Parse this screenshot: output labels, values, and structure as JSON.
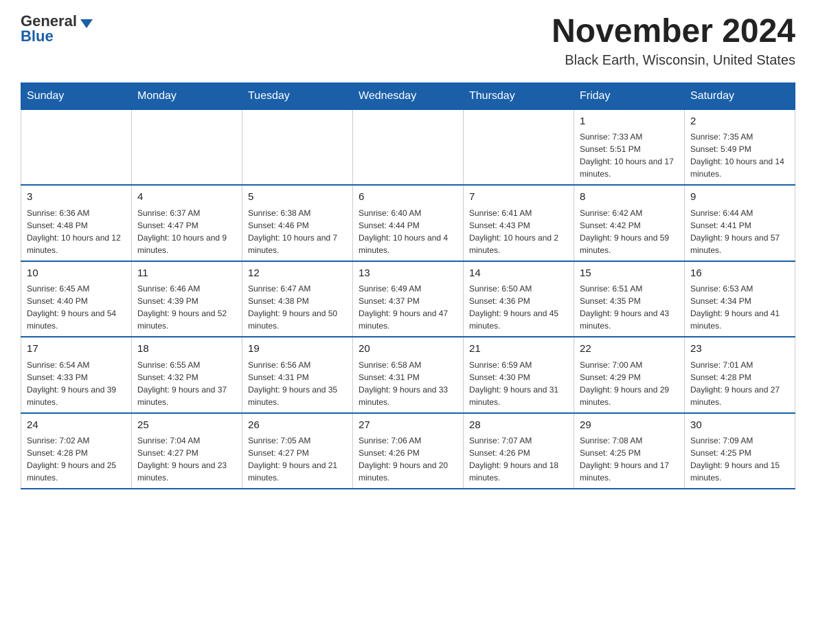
{
  "logo": {
    "general": "General",
    "blue": "Blue"
  },
  "title": "November 2024",
  "location": "Black Earth, Wisconsin, United States",
  "days_of_week": [
    "Sunday",
    "Monday",
    "Tuesday",
    "Wednesday",
    "Thursday",
    "Friday",
    "Saturday"
  ],
  "weeks": [
    [
      {
        "day": "",
        "sunrise": "",
        "sunset": "",
        "daylight": ""
      },
      {
        "day": "",
        "sunrise": "",
        "sunset": "",
        "daylight": ""
      },
      {
        "day": "",
        "sunrise": "",
        "sunset": "",
        "daylight": ""
      },
      {
        "day": "",
        "sunrise": "",
        "sunset": "",
        "daylight": ""
      },
      {
        "day": "",
        "sunrise": "",
        "sunset": "",
        "daylight": ""
      },
      {
        "day": "1",
        "sunrise": "Sunrise: 7:33 AM",
        "sunset": "Sunset: 5:51 PM",
        "daylight": "Daylight: 10 hours and 17 minutes."
      },
      {
        "day": "2",
        "sunrise": "Sunrise: 7:35 AM",
        "sunset": "Sunset: 5:49 PM",
        "daylight": "Daylight: 10 hours and 14 minutes."
      }
    ],
    [
      {
        "day": "3",
        "sunrise": "Sunrise: 6:36 AM",
        "sunset": "Sunset: 4:48 PM",
        "daylight": "Daylight: 10 hours and 12 minutes."
      },
      {
        "day": "4",
        "sunrise": "Sunrise: 6:37 AM",
        "sunset": "Sunset: 4:47 PM",
        "daylight": "Daylight: 10 hours and 9 minutes."
      },
      {
        "day": "5",
        "sunrise": "Sunrise: 6:38 AM",
        "sunset": "Sunset: 4:46 PM",
        "daylight": "Daylight: 10 hours and 7 minutes."
      },
      {
        "day": "6",
        "sunrise": "Sunrise: 6:40 AM",
        "sunset": "Sunset: 4:44 PM",
        "daylight": "Daylight: 10 hours and 4 minutes."
      },
      {
        "day": "7",
        "sunrise": "Sunrise: 6:41 AM",
        "sunset": "Sunset: 4:43 PM",
        "daylight": "Daylight: 10 hours and 2 minutes."
      },
      {
        "day": "8",
        "sunrise": "Sunrise: 6:42 AM",
        "sunset": "Sunset: 4:42 PM",
        "daylight": "Daylight: 9 hours and 59 minutes."
      },
      {
        "day": "9",
        "sunrise": "Sunrise: 6:44 AM",
        "sunset": "Sunset: 4:41 PM",
        "daylight": "Daylight: 9 hours and 57 minutes."
      }
    ],
    [
      {
        "day": "10",
        "sunrise": "Sunrise: 6:45 AM",
        "sunset": "Sunset: 4:40 PM",
        "daylight": "Daylight: 9 hours and 54 minutes."
      },
      {
        "day": "11",
        "sunrise": "Sunrise: 6:46 AM",
        "sunset": "Sunset: 4:39 PM",
        "daylight": "Daylight: 9 hours and 52 minutes."
      },
      {
        "day": "12",
        "sunrise": "Sunrise: 6:47 AM",
        "sunset": "Sunset: 4:38 PM",
        "daylight": "Daylight: 9 hours and 50 minutes."
      },
      {
        "day": "13",
        "sunrise": "Sunrise: 6:49 AM",
        "sunset": "Sunset: 4:37 PM",
        "daylight": "Daylight: 9 hours and 47 minutes."
      },
      {
        "day": "14",
        "sunrise": "Sunrise: 6:50 AM",
        "sunset": "Sunset: 4:36 PM",
        "daylight": "Daylight: 9 hours and 45 minutes."
      },
      {
        "day": "15",
        "sunrise": "Sunrise: 6:51 AM",
        "sunset": "Sunset: 4:35 PM",
        "daylight": "Daylight: 9 hours and 43 minutes."
      },
      {
        "day": "16",
        "sunrise": "Sunrise: 6:53 AM",
        "sunset": "Sunset: 4:34 PM",
        "daylight": "Daylight: 9 hours and 41 minutes."
      }
    ],
    [
      {
        "day": "17",
        "sunrise": "Sunrise: 6:54 AM",
        "sunset": "Sunset: 4:33 PM",
        "daylight": "Daylight: 9 hours and 39 minutes."
      },
      {
        "day": "18",
        "sunrise": "Sunrise: 6:55 AM",
        "sunset": "Sunset: 4:32 PM",
        "daylight": "Daylight: 9 hours and 37 minutes."
      },
      {
        "day": "19",
        "sunrise": "Sunrise: 6:56 AM",
        "sunset": "Sunset: 4:31 PM",
        "daylight": "Daylight: 9 hours and 35 minutes."
      },
      {
        "day": "20",
        "sunrise": "Sunrise: 6:58 AM",
        "sunset": "Sunset: 4:31 PM",
        "daylight": "Daylight: 9 hours and 33 minutes."
      },
      {
        "day": "21",
        "sunrise": "Sunrise: 6:59 AM",
        "sunset": "Sunset: 4:30 PM",
        "daylight": "Daylight: 9 hours and 31 minutes."
      },
      {
        "day": "22",
        "sunrise": "Sunrise: 7:00 AM",
        "sunset": "Sunset: 4:29 PM",
        "daylight": "Daylight: 9 hours and 29 minutes."
      },
      {
        "day": "23",
        "sunrise": "Sunrise: 7:01 AM",
        "sunset": "Sunset: 4:28 PM",
        "daylight": "Daylight: 9 hours and 27 minutes."
      }
    ],
    [
      {
        "day": "24",
        "sunrise": "Sunrise: 7:02 AM",
        "sunset": "Sunset: 4:28 PM",
        "daylight": "Daylight: 9 hours and 25 minutes."
      },
      {
        "day": "25",
        "sunrise": "Sunrise: 7:04 AM",
        "sunset": "Sunset: 4:27 PM",
        "daylight": "Daylight: 9 hours and 23 minutes."
      },
      {
        "day": "26",
        "sunrise": "Sunrise: 7:05 AM",
        "sunset": "Sunset: 4:27 PM",
        "daylight": "Daylight: 9 hours and 21 minutes."
      },
      {
        "day": "27",
        "sunrise": "Sunrise: 7:06 AM",
        "sunset": "Sunset: 4:26 PM",
        "daylight": "Daylight: 9 hours and 20 minutes."
      },
      {
        "day": "28",
        "sunrise": "Sunrise: 7:07 AM",
        "sunset": "Sunset: 4:26 PM",
        "daylight": "Daylight: 9 hours and 18 minutes."
      },
      {
        "day": "29",
        "sunrise": "Sunrise: 7:08 AM",
        "sunset": "Sunset: 4:25 PM",
        "daylight": "Daylight: 9 hours and 17 minutes."
      },
      {
        "day": "30",
        "sunrise": "Sunrise: 7:09 AM",
        "sunset": "Sunset: 4:25 PM",
        "daylight": "Daylight: 9 hours and 15 minutes."
      }
    ]
  ]
}
